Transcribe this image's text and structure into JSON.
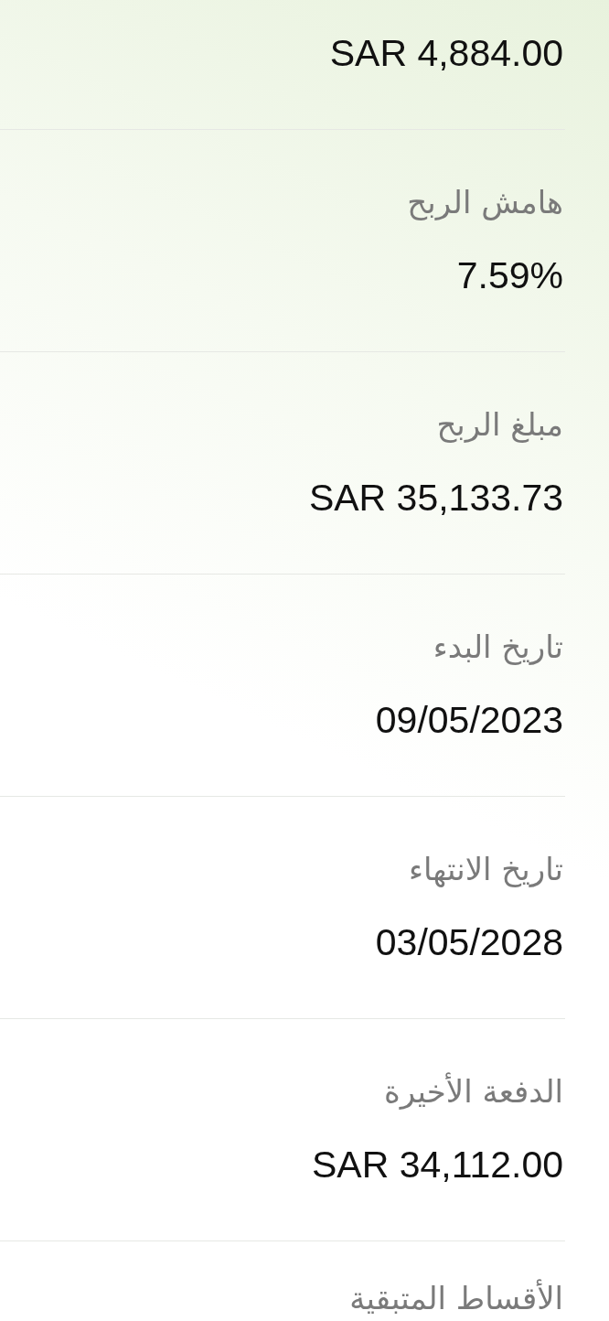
{
  "fields": [
    {
      "value": "SAR 4,884.00"
    },
    {
      "label": "هامش الربح",
      "value": "7.59%"
    },
    {
      "label": "مبلغ الربح",
      "value": "SAR 35,133.73"
    },
    {
      "label": "تاريخ البدء",
      "value": "09/05/2023"
    },
    {
      "label": "تاريخ الانتهاء",
      "value": "03/05/2028"
    },
    {
      "label": "الدفعة الأخيرة",
      "value": "SAR 34,112.00"
    },
    {
      "label": "الأقساط المتبقية"
    }
  ]
}
